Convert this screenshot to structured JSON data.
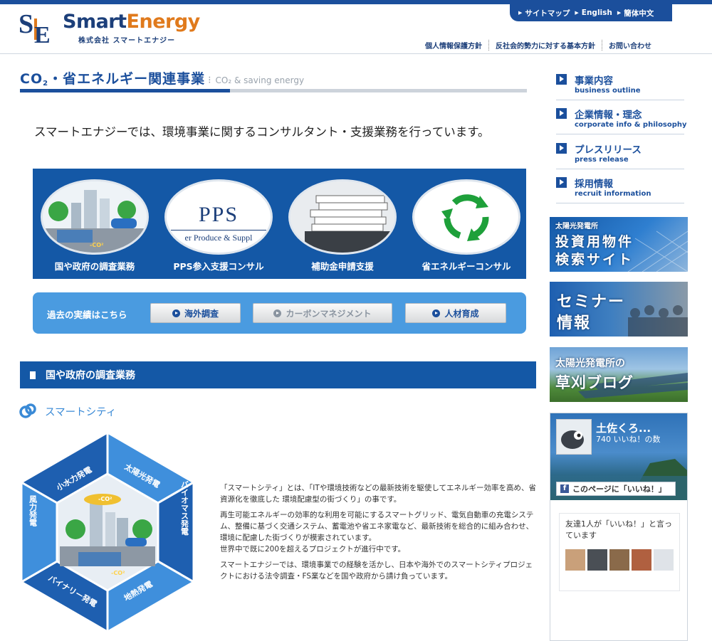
{
  "header": {
    "logo_smart": "Smart",
    "logo_energy": "Energy",
    "logo_sub": "株式会社 スマートエナジー",
    "top_nav": [
      "サイトマップ",
      "English",
      "簡体中文"
    ],
    "util_nav": [
      "個人情報保護方針",
      "反社会的勢力に対する基本方針",
      "お問い合わせ"
    ]
  },
  "page": {
    "title_jp": "CO",
    "title_jp_sub": "2",
    "title_jp_rest": "・省エネルギー関連事業",
    "title_en": "CO₂ & saving energy",
    "lead": "スマートエナジーでは、環境事業に関するコンサルタント・支援業務を行っています。"
  },
  "services": [
    {
      "label": "国や政府の調査業務"
    },
    {
      "label": "PPS参入支援コンサル",
      "image_text": "PPS",
      "image_sub": "er Produce & Suppl"
    },
    {
      "label": "補助金申請支援"
    },
    {
      "label": "省エネルギーコンサル"
    }
  ],
  "achievements": {
    "title": "過去の実績はこちら",
    "buttons": [
      "海外調査",
      "カーボンマネジメント",
      "人材育成"
    ]
  },
  "section": {
    "title": "国や政府の調査業務",
    "subtitle": "スマートシティ"
  },
  "hexagon": {
    "segments": [
      "小水力発電",
      "太陽光発電",
      "バイオマス発電",
      "地熱発電",
      "バイナリー発電",
      "風力発電"
    ],
    "co2": "-CO²"
  },
  "body": {
    "p1": "「スマートシティ」とは、「ITや環境技術などの最新技術を駆使してエネルギー効率を高め、省資源化を徹底した 環境配慮型の街づくり」の事です。",
    "p2a": "再生可能エネルギーの効率的な利用を可能にするスマートグリッド、電気自動車の充電システム、整備に基づく交通システム、蓄電池や省エネ家電など、最新技術を総合的に組み合わせ、環境に配慮した街づくりが模索されています。",
    "p2b": "世界中で既に200を超えるプロジェクトが進行中です。",
    "p3": "スマートエナジーでは、環境事業での経験を活かし、日本や海外でのスマートシティプロジェクトにおける法令調査・FS業などを国や政府から請け負っています。"
  },
  "sidebar": {
    "nav": [
      {
        "jp": "事業内容",
        "en": "business outline"
      },
      {
        "jp": "企業情報・理念",
        "en": "corporate info & philosophy"
      },
      {
        "jp": "プレスリリース",
        "en": "press release"
      },
      {
        "jp": "採用情報",
        "en": "recruit information"
      }
    ],
    "banners": [
      {
        "line1": "太陽光発電所",
        "line2": "投資用物件",
        "line3": "検索サイト"
      },
      {
        "line1": "セミナー",
        "line2": "情報"
      },
      {
        "line1": "太陽光発電所の",
        "line2": "草刈ブログ"
      }
    ],
    "facebook": {
      "name": "土佐くろ...",
      "likes": "740 いいね！の数",
      "like_button": "このページに「いいね！」",
      "friends_text": "友達1人が「いいね！」と言っています"
    }
  },
  "colors": {
    "primary": "#1458a6",
    "navy": "#1b4f9c",
    "accent_orange": "#e07a1c",
    "light_blue": "#4a9be0"
  }
}
